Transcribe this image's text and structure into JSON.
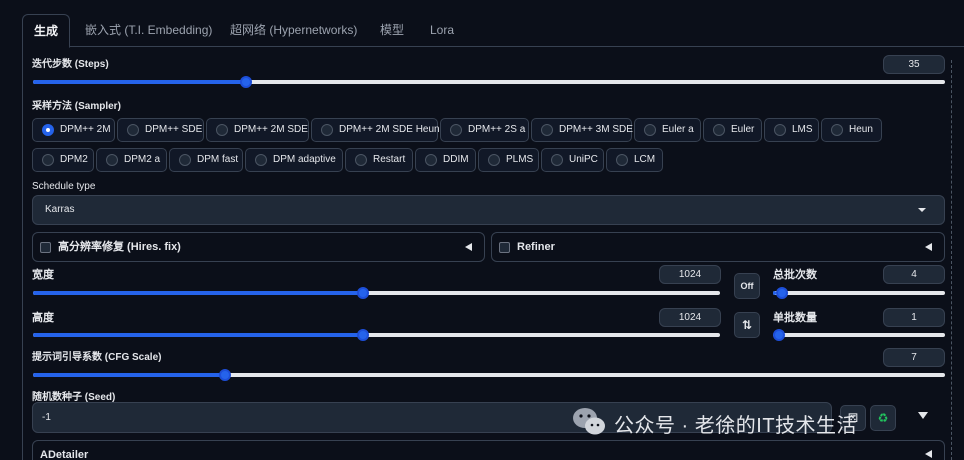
{
  "tabs": [
    {
      "label": "生成",
      "active": true
    },
    {
      "label": "嵌入式 (T.I. Embedding)",
      "active": false
    },
    {
      "label": "超网络 (Hypernetworks)",
      "active": false
    },
    {
      "label": "模型",
      "active": false
    },
    {
      "label": "Lora",
      "active": false
    }
  ],
  "steps": {
    "label": "迭代步数 (Steps)",
    "value": "35",
    "fraction": 0.234
  },
  "sampler": {
    "label": "采样方法 (Sampler)",
    "selected": "DPM++ 2M",
    "options": [
      "DPM++ 2M",
      "DPM++ SDE",
      "DPM++ 2M SDE",
      "DPM++ 2M SDE Heun",
      "DPM++ 2S a",
      "DPM++ 3M SDE",
      "Euler a",
      "Euler",
      "LMS",
      "Heun",
      "DPM2",
      "DPM2 a",
      "DPM fast",
      "DPM adaptive",
      "Restart",
      "DDIM",
      "PLMS",
      "UniPC",
      "LCM"
    ]
  },
  "schedule": {
    "label": "Schedule type",
    "value": "Karras"
  },
  "hires": {
    "label": "高分辨率修复 (Hires. fix)"
  },
  "refiner": {
    "label": "Refiner"
  },
  "width": {
    "label": "宽度",
    "value": "1024",
    "fraction": 0.48
  },
  "height": {
    "label": "高度",
    "value": "1024",
    "fraction": 0.48
  },
  "off_button": {
    "label": "Off"
  },
  "swap_icon": "swap-vertical-icon",
  "batch_count": {
    "label": "总批次数",
    "value": "4",
    "fraction": 0.02
  },
  "batch_size": {
    "label": "单批数量",
    "value": "1",
    "fraction": 0.0
  },
  "cfg": {
    "label": "提示词引导系数 (CFG Scale)",
    "value": "7",
    "fraction": 0.211
  },
  "seed": {
    "label": "随机数种子 (Seed)",
    "value": "-1"
  },
  "adetailer": {
    "label": "ADetailer"
  },
  "watermark": {
    "text": "公众号 · 老徐的IT技术生活",
    "icon": "wechat-icon"
  },
  "colors": {
    "accent": "#2563eb",
    "background": "#0b0f19",
    "surface": "#1f2937",
    "border": "#374151"
  }
}
